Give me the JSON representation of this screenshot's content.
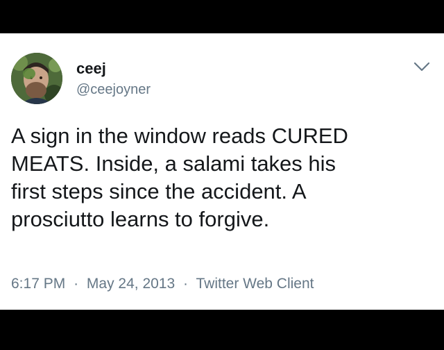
{
  "tweet": {
    "author": {
      "name": "ceej",
      "handle": "@ceejoyner",
      "avatar_icon": "user-avatar-photo"
    },
    "menu_icon": "chevron-down-icon",
    "text": "A sign in the window reads CURED\nMEATS. Inside, a salami takes his\nfirst steps since the accident. A\nprosciutto learns to forgive.",
    "time": "6:17 PM",
    "date": "May 24, 2013",
    "separator": "·",
    "client": "Twitter Web Client"
  },
  "colors": {
    "background_frame": "#000000",
    "card": "#ffffff",
    "text_primary": "#14171a",
    "text_secondary": "#657786"
  }
}
